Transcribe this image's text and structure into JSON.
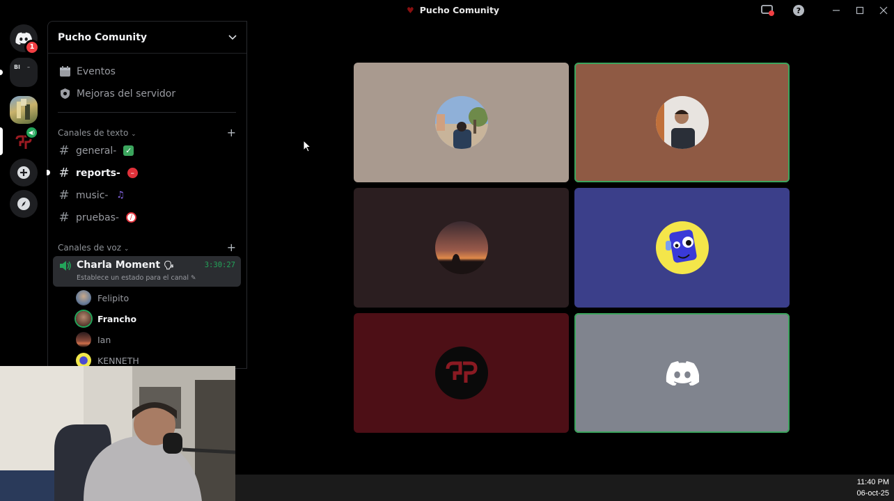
{
  "window": {
    "title": "Pucho Comunity",
    "title_icon": "heart-logo-icon",
    "controls": [
      "screen-share-icon",
      "help-icon",
      "minimize-icon",
      "maximize-icon",
      "close-icon"
    ]
  },
  "rail": {
    "home_badge": "1",
    "folder_label": "Bl",
    "folder_label2": "–"
  },
  "sidebar": {
    "server_name": "Pucho Comunity",
    "links": [
      {
        "label": "Eventos",
        "icon": "calendar-icon"
      },
      {
        "label": "Mejoras del servidor",
        "icon": "boost-shield-icon"
      }
    ],
    "text_category": "Canales de texto",
    "text_channels": [
      {
        "label": "general-",
        "emoji": "✅",
        "unread": false
      },
      {
        "label": "reports-",
        "emoji": "⛔",
        "unread": true
      },
      {
        "label": "music-",
        "emoji": "🎶",
        "unread": false
      },
      {
        "label": "pruebas-",
        "emoji": "🚫",
        "unread": false
      }
    ],
    "voice_category": "Canales de voz",
    "voice_channel": {
      "name": "Charla Moment",
      "name_emoji": "🗣",
      "timer": "3:30:27",
      "status": "Establece un estado para el canal"
    },
    "members": [
      {
        "name": "Felipito",
        "speaking": false
      },
      {
        "name": "Francho",
        "speaking": true
      },
      {
        "name": "Ian",
        "speaking": false
      },
      {
        "name": "KENNETH",
        "speaking": false
      }
    ]
  },
  "video_tiles": [
    {
      "bg": "#a99a8f",
      "speaking": false,
      "avatar": "photo-plaza"
    },
    {
      "bg": "#8f5a44",
      "speaking": true,
      "avatar": "photo-mirror-selfie"
    },
    {
      "bg": "#2b1e20",
      "speaking": false,
      "avatar": "photo-sunset"
    },
    {
      "bg": "#3b3f8a",
      "speaking": false,
      "avatar": "blue-cartoon"
    },
    {
      "bg": "#4d0f16",
      "speaking": false,
      "avatar": "pucho-logo"
    },
    {
      "bg": "#80848e",
      "speaking": true,
      "avatar": "discord-default"
    }
  ],
  "colors": {
    "speaking_green": "#3ba55d",
    "timer_green": "#23a55a",
    "notification_red": "#f23f43"
  },
  "taskbar": {
    "time": "11:40 PM",
    "date": "06-oct-25"
  }
}
